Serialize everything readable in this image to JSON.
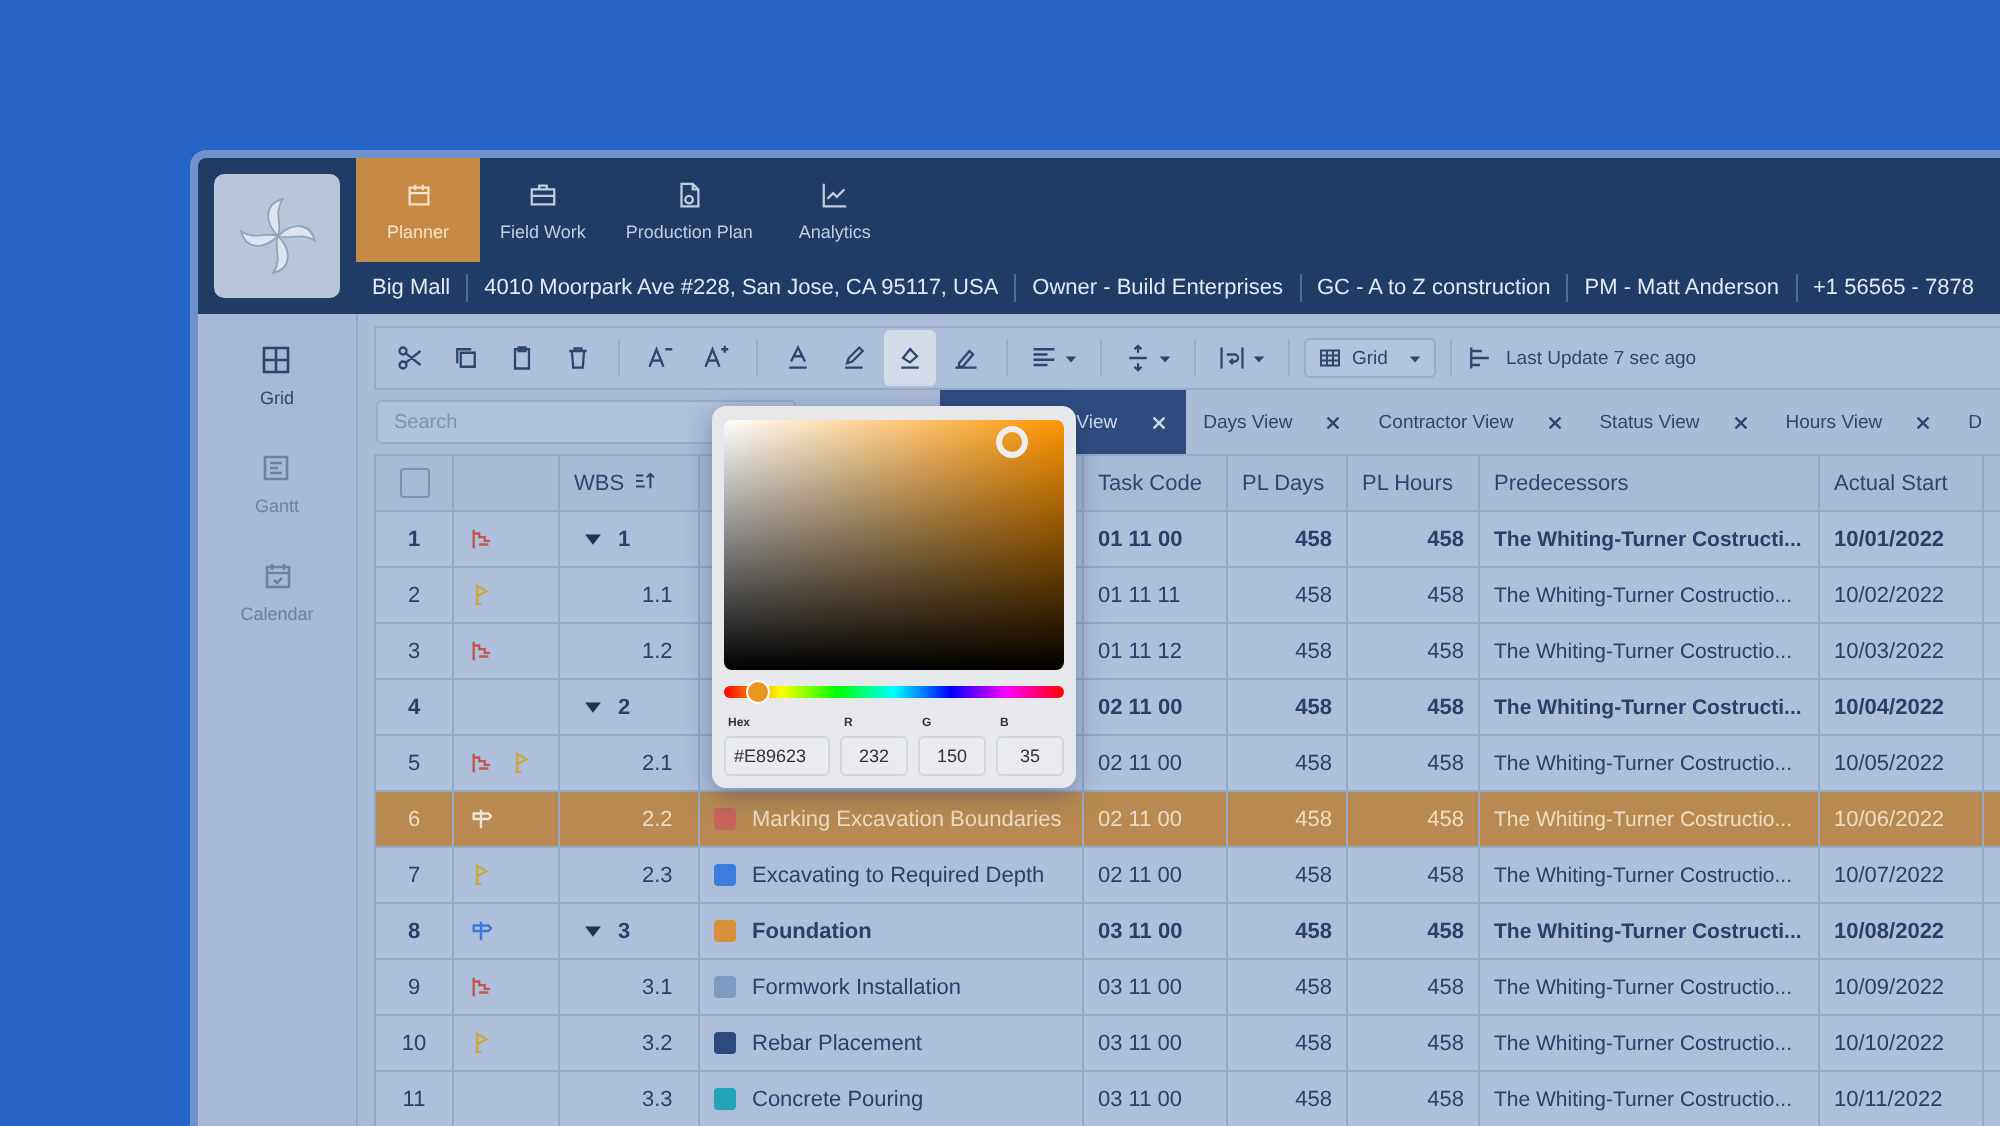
{
  "nav": {
    "tabs": [
      {
        "label": "Planner",
        "selected": true
      },
      {
        "label": "Field Work",
        "selected": false
      },
      {
        "label": "Production Plan",
        "selected": false
      },
      {
        "label": "Analytics",
        "selected": false
      }
    ]
  },
  "project_bar": [
    "Big Mall",
    "4010 Moorpark Ave #228, San Jose, CA 95117, USA",
    "Owner - Build Enterprises",
    "GC - A to Z construction",
    "PM -  Matt Anderson",
    "+1 56565 - 7878"
  ],
  "sidebar": {
    "items": [
      {
        "label": "Grid",
        "selected": true
      },
      {
        "label": "Gantt",
        "selected": false
      },
      {
        "label": "Calendar",
        "selected": false
      }
    ]
  },
  "toolbar": {
    "tools": [
      {
        "selected": false
      },
      {
        "selected": false
      },
      {
        "selected": false
      },
      {
        "selected": false
      },
      {
        "selected": false
      },
      {
        "selected": false
      },
      {
        "selected": false
      },
      {
        "selected": false
      },
      {
        "selected": true
      },
      {
        "selected": false
      },
      {
        "selected": false
      },
      {
        "selected": false
      },
      {
        "selected": false
      }
    ],
    "view_select": {
      "value": "Grid"
    },
    "last_update": "Last Update 7 sec ago"
  },
  "search": {
    "placeholder": "Search"
  },
  "views": [
    {
      "label": "View",
      "selected": true
    },
    {
      "label": "Days View",
      "selected": false
    },
    {
      "label": "Contractor View",
      "selected": false
    },
    {
      "label": "Status View",
      "selected": false
    },
    {
      "label": "Hours View",
      "selected": false
    },
    {
      "label": "D",
      "selected": false
    }
  ],
  "table": {
    "select_all": {
      "checked": false
    },
    "columns": [
      "WBS",
      "Task Code",
      "PL Days",
      "PL Hours",
      "Predecessors",
      "Actual Start"
    ],
    "rows": [
      {
        "num": "1",
        "icons": [
          {
            "kind": "steps"
          }
        ],
        "wbs": "1",
        "group": true,
        "expanded": true,
        "code": "01 11 00",
        "pl_days": "458",
        "pl_hours": "458",
        "predecessors": "The Whiting-Turner Costructi...",
        "actual_start": "10/01/2022",
        "selected": false
      },
      {
        "num": "2",
        "icons": [
          {
            "kind": "flag"
          }
        ],
        "wbs": "1.1",
        "group": false,
        "code": "01 11 11",
        "pl_days": "458",
        "pl_hours": "458",
        "predecessors": "The Whiting-Turner Costructio...",
        "actual_start": "10/02/2022",
        "selected": false
      },
      {
        "num": "3",
        "icons": [
          {
            "kind": "steps"
          }
        ],
        "wbs": "1.2",
        "group": false,
        "code": "01 11 12",
        "pl_days": "458",
        "pl_hours": "458",
        "predecessors": "The Whiting-Turner Costructio...",
        "actual_start": "10/03/2022",
        "selected": false
      },
      {
        "num": "4",
        "icons": [],
        "wbs": "2",
        "group": true,
        "expanded": true,
        "code": "02 11 00",
        "pl_days": "458",
        "pl_hours": "458",
        "predecessors": "The Whiting-Turner Costructi...",
        "actual_start": "10/04/2022",
        "selected": false
      },
      {
        "num": "5",
        "icons": [
          {
            "kind": "steps"
          },
          {
            "kind": "flag"
          }
        ],
        "wbs": "2.1",
        "group": false,
        "code": "02 11 00",
        "pl_days": "458",
        "pl_hours": "458",
        "predecessors": "The Whiting-Turner Costructio...",
        "actual_start": "10/05/2022",
        "selected": false
      },
      {
        "num": "6",
        "icons": [
          {
            "kind": "signpost"
          }
        ],
        "wbs": "2.2",
        "group": false,
        "task": "Marking Excavation Boundaries",
        "color": "#c8645c",
        "code": "02 11 00",
        "pl_days": "458",
        "pl_hours": "458",
        "predecessors": "The Whiting-Turner Costructio...",
        "actual_start": "10/06/2022",
        "selected": true
      },
      {
        "num": "7",
        "icons": [
          {
            "kind": "flag"
          }
        ],
        "wbs": "2.3",
        "group": false,
        "task": "Excavating to Required Depth",
        "color": "#3b7ddd",
        "code": "02 11 00",
        "pl_days": "458",
        "pl_hours": "458",
        "predecessors": "The Whiting-Turner Costructio...",
        "actual_start": "10/07/2022",
        "selected": false
      },
      {
        "num": "8",
        "icons": [
          {
            "kind": "signpost"
          }
        ],
        "wbs": "3",
        "group": true,
        "expanded": true,
        "task": "Foundation",
        "color": "#d8913a",
        "code": "03 11 00",
        "pl_days": "458",
        "pl_hours": "458",
        "predecessors": "The Whiting-Turner Costructi...",
        "actual_start": "10/08/2022",
        "selected": false
      },
      {
        "num": "9",
        "icons": [
          {
            "kind": "steps"
          }
        ],
        "wbs": "3.1",
        "group": false,
        "task": "Formwork Installation",
        "color": "#7d9cc4",
        "code": "03 11 00",
        "pl_days": "458",
        "pl_hours": "458",
        "predecessors": "The Whiting-Turner Costructio...",
        "actual_start": "10/09/2022",
        "selected": false
      },
      {
        "num": "10",
        "icons": [
          {
            "kind": "flag"
          }
        ],
        "wbs": "3.2",
        "group": false,
        "task": "Rebar Placement",
        "color": "#2c4a7a",
        "code": "03 11 00",
        "pl_days": "458",
        "pl_hours": "458",
        "predecessors": "The Whiting-Turner Costructio...",
        "actual_start": "10/10/2022",
        "selected": false
      },
      {
        "num": "11",
        "icons": [],
        "wbs": "3.3",
        "group": false,
        "task": "Concrete Pouring",
        "color": "#1fa5b5",
        "code": "03 11 00",
        "pl_days": "458",
        "pl_hours": "458",
        "predecessors": "The Whiting-Turner Costructio...",
        "actual_start": "10/11/2022",
        "selected": false
      }
    ]
  },
  "color_picker": {
    "labels": [
      "Hex",
      "R",
      "G",
      "B"
    ],
    "hex": "#E89623",
    "r": "232",
    "g": "150",
    "b": "35"
  }
}
